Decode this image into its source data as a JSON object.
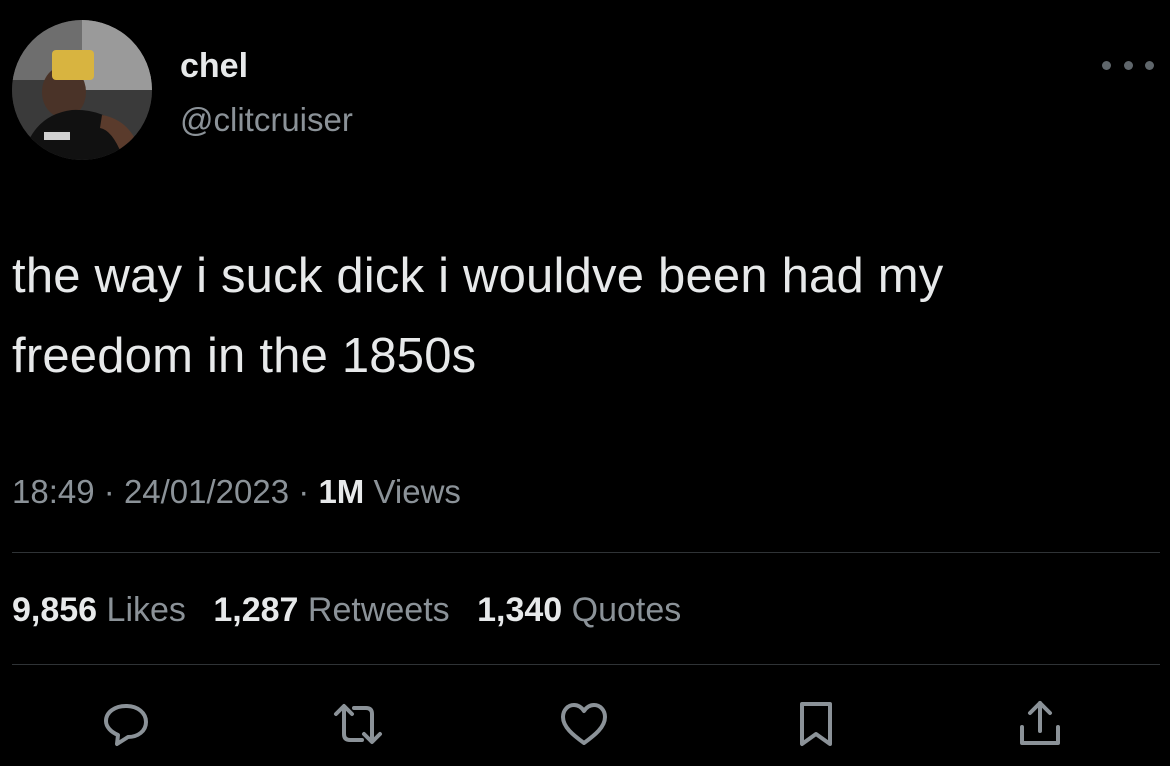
{
  "user": {
    "display_name": "chel",
    "handle": "@clitcruiser",
    "avatar_icon": "profile-photo"
  },
  "tweet": {
    "text_line1": "the way i suck dick i wouldve been had my",
    "text_line2": "freedom in the 1850s"
  },
  "meta": {
    "time": "18:49",
    "separator": "·",
    "date": "24/01/2023",
    "views_count": "1M",
    "views_label": "Views"
  },
  "stats": {
    "likes_count": "9,856",
    "likes_label": "Likes",
    "retweets_count": "1,287",
    "retweets_label": "Retweets",
    "quotes_count": "1,340",
    "quotes_label": "Quotes"
  },
  "actions": [
    {
      "name": "reply",
      "icon": "speech-bubble-icon"
    },
    {
      "name": "retweet",
      "icon": "retweet-arrows-icon"
    },
    {
      "name": "like",
      "icon": "heart-icon"
    },
    {
      "name": "bookmark",
      "icon": "bookmark-icon"
    },
    {
      "name": "share",
      "icon": "share-upload-icon"
    }
  ],
  "colors": {
    "background": "#000000",
    "primary_text": "#e7e9ea",
    "secondary_text": "#8b9298",
    "divider": "#2f3336",
    "icon": "#8b9298"
  }
}
